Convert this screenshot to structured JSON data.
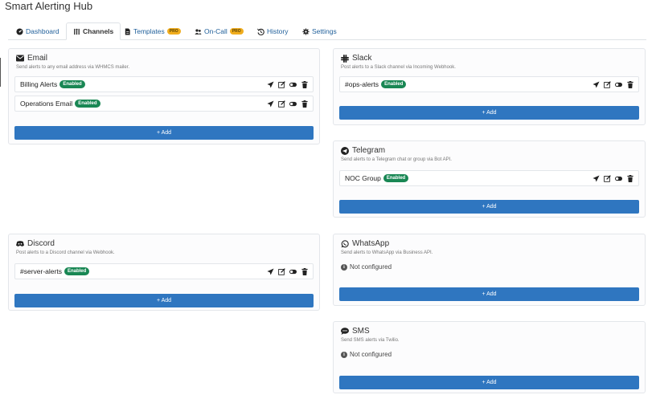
{
  "app": {
    "title": "Smart Alerting Hub"
  },
  "tabs": [
    {
      "label": "Dashboard",
      "icon": "dashboard-icon",
      "active": false,
      "pro": false
    },
    {
      "label": "Channels",
      "icon": "channels-icon",
      "active": true,
      "pro": false
    },
    {
      "label": "Templates",
      "icon": "file-icon",
      "active": false,
      "pro": true
    },
    {
      "label": "On-Call",
      "icon": "users-icon",
      "active": false,
      "pro": true
    },
    {
      "label": "History",
      "icon": "history-icon",
      "active": false,
      "pro": false
    },
    {
      "label": "Settings",
      "icon": "gear-icon",
      "active": false,
      "pro": false
    }
  ],
  "pro_badge": "PRO",
  "enabled_badge": "Enabled",
  "add_label": "+ Add",
  "not_configured": "Not configured",
  "channels": {
    "email": {
      "title": "Email",
      "description": "Send alerts to any email address via WHMCS mailer.",
      "rows": [
        "Billing Alerts",
        "Operations Email"
      ]
    },
    "slack": {
      "title": "Slack",
      "description": "Post alerts to a Slack channel via Incoming Webhook.",
      "rows": [
        "#ops-alerts"
      ]
    },
    "telegram": {
      "title": "Telegram",
      "description": "Send alerts to a Telegram chat or group via Bot API.",
      "rows": [
        "NOC Group"
      ]
    },
    "discord": {
      "title": "Discord",
      "description": "Post alerts to a Discord channel via Webhook.",
      "rows": [
        "#server-alerts"
      ]
    },
    "whatsapp": {
      "title": "WhatsApp",
      "description": "Send alerts to WhatsApp via Business API.",
      "rows": []
    },
    "sms": {
      "title": "SMS",
      "description": "Send SMS alerts via Twilio.",
      "rows": []
    }
  },
  "colors": {
    "accent": "#2f76c0",
    "enabled": "#198754",
    "pro": "#f0ad1e",
    "link": "#1f5f9a"
  }
}
